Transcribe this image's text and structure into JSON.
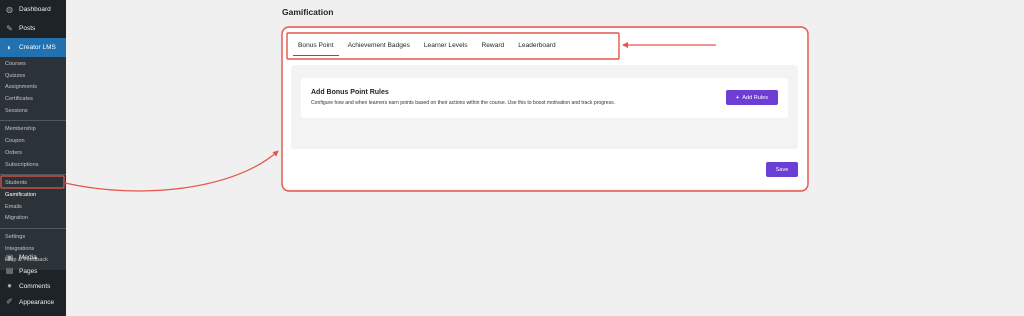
{
  "sidebar": {
    "top_items": [
      {
        "label": "Dashboard",
        "icon": "dashboard-icon"
      },
      {
        "label": "Posts",
        "icon": "pin-icon"
      },
      {
        "label": "Creator LMS",
        "icon": "creator-lms-icon"
      }
    ],
    "sub_groups": [
      [
        "Courses",
        "Quizzes",
        "Assignments",
        "Certificates",
        "Sessions"
      ],
      [
        "Membership",
        "Coupon",
        "Orders",
        "Subscriptions"
      ],
      [
        "Students",
        "Gamification",
        "Emails",
        "Migration"
      ],
      [
        "Settings",
        "Integrations",
        "Help & Feedback"
      ]
    ],
    "bottom_items": [
      {
        "label": "Media",
        "icon": "media-icon"
      },
      {
        "label": "Pages",
        "icon": "pages-icon"
      },
      {
        "label": "Comments",
        "icon": "comments-icon"
      },
      {
        "label": "Appearance",
        "icon": "appearance-icon"
      }
    ]
  },
  "page": {
    "title": "Gamification"
  },
  "tabs": [
    "Bonus Point",
    "Achievement Badges",
    "Learner Levels",
    "Reward",
    "Leaderboard"
  ],
  "rules": {
    "title": "Add Bonus Point Rules",
    "description": "Configure how and when learners earn points based on their actions within the course. Use this to boost motivation and track progress.",
    "add_label": "Add Rules"
  },
  "save_label": "Save",
  "colors": {
    "sidebar_bg": "#1d2327",
    "active_menu": "#2271b1",
    "button": "#6b3fd4",
    "annotation": "#e5554b"
  }
}
